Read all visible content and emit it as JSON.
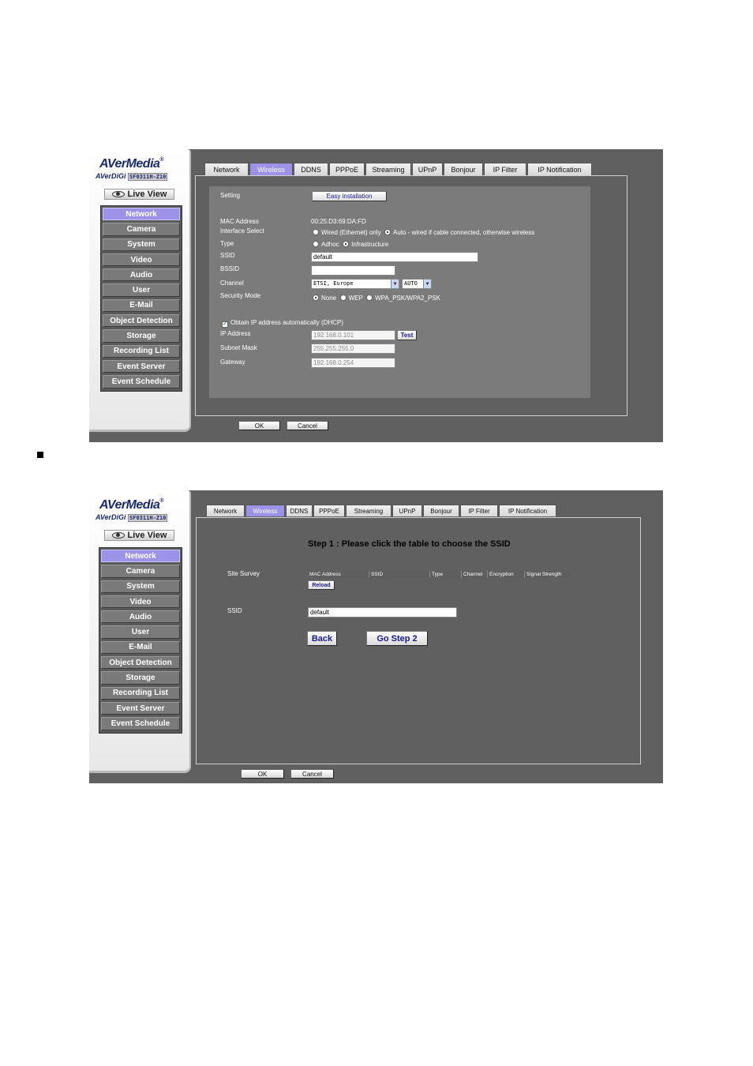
{
  "brand": {
    "name": "AVerMedia",
    "reg": "®",
    "sub": "AVerDiGi",
    "model": "SF0311H-Z10",
    "live_view": "Live View"
  },
  "menu": [
    "Network",
    "Camera",
    "System",
    "Video",
    "Audio",
    "User",
    "E-Mail",
    "Object Detection",
    "Storage",
    "Recording List",
    "Event Server",
    "Event Schedule"
  ],
  "tabs": [
    "Network",
    "Wireless",
    "DDNS",
    "PPPoE",
    "Streaming",
    "UPnP",
    "Bonjour",
    "IP Filter",
    "IP Notification"
  ],
  "active_tab": "Wireless",
  "form1": {
    "setting_label": "Setting",
    "easy_install": "Easy installation",
    "mac_label": "MAC Address",
    "mac_value": "00:25:D3:69:DA:FD",
    "iface_label": "Interface Select",
    "iface_opt1": "Wired (Ethernet) only",
    "iface_opt2": "Auto - wired if cable connected, otherwise wireless",
    "type_label": "Type",
    "type_opt1": "Adhoc",
    "type_opt2": "Infrastructure",
    "ssid_label": "SSID",
    "ssid_value": "default",
    "bssid_label": "BSSID",
    "bssid_value": "",
    "channel_label": "Channel",
    "channel_region": "ETSI, Europe",
    "channel_value": "AUTO",
    "security_label": "Security Mode",
    "sec_opt1": "None",
    "sec_opt2": "WEP",
    "sec_opt3": "WPA_PSK/WPA2_PSK",
    "dhcp_label": "Obtain IP address automatically (DHCP)",
    "ip_label": "IP Address",
    "ip_value": "192.168.0.101",
    "test_button": "Test",
    "mask_label": "Subnet Mask",
    "mask_value": "255.255.255.0",
    "gw_label": "Gateway",
    "gw_value": "192.168.0.254"
  },
  "form2": {
    "step_title": "Step 1 : Please click the table to choose the SSID",
    "site_survey_label": "Site Survey",
    "columns": [
      "MAC Address",
      "SSID",
      "Type",
      "Channel",
      "Encryption",
      "Signal Strength"
    ],
    "reload_button": "Reload",
    "ssid_label": "SSID",
    "ssid_value": "default",
    "back_button": "Back",
    "next_button": "Go Step 2"
  },
  "footer": {
    "ok": "OK",
    "cancel": "Cancel"
  }
}
